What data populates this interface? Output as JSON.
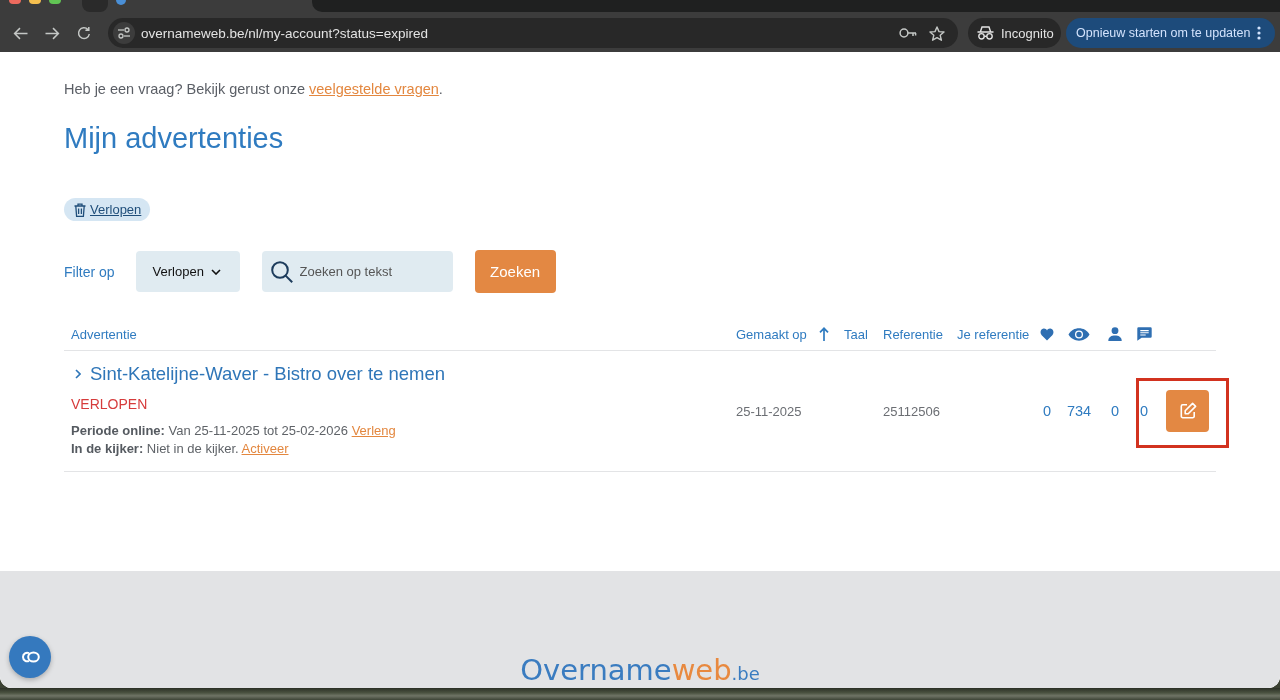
{
  "browser": {
    "url": "overnameweb.be/nl/my-account?status=expired",
    "profile": "Incognito",
    "update_button": "Opnieuw starten om te updaten"
  },
  "intro": {
    "text": "Heb je een vraag? Bekijk gerust onze",
    "link": "veelgestelde vragen",
    "end": "."
  },
  "heading": "Mijn advertenties",
  "active_filters": [
    {
      "label": "Verlopen"
    }
  ],
  "filter": {
    "label": "Filter op",
    "value": "Verlopen",
    "search_placeholder": "Zoeken op tekst",
    "button": "Zoeken"
  },
  "table": {
    "columns": [
      {
        "label": "Advertentie",
        "sorted": false
      },
      {
        "label": "Gemaakt op",
        "sorted": true
      },
      {
        "label": "Taal",
        "sorted": false
      },
      {
        "label": "Referentie",
        "sorted": false
      },
      {
        "label": "Je referentie",
        "sorted": false
      }
    ],
    "rows": [
      {
        "title": "Sint-Katelijne-Waver - Bistro over te nemen",
        "expanded": false,
        "status": "VERLOPEN",
        "period": "**Periode online:** Van 25-11-2025 tot 25-02-2026",
        "period_link": "Verleng",
        "featured": "**In de kijker:** Niet in de kijker.",
        "featured_link": "Activeer",
        "created": "25-11-2025",
        "reference": "25112506",
        "stats": [
          "0",
          "734",
          "0",
          "0"
        ],
        "highlighted": true
      }
    ]
  },
  "footer": {
    "logo": [
      "Overname",
      "web",
      ".be"
    ]
  }
}
